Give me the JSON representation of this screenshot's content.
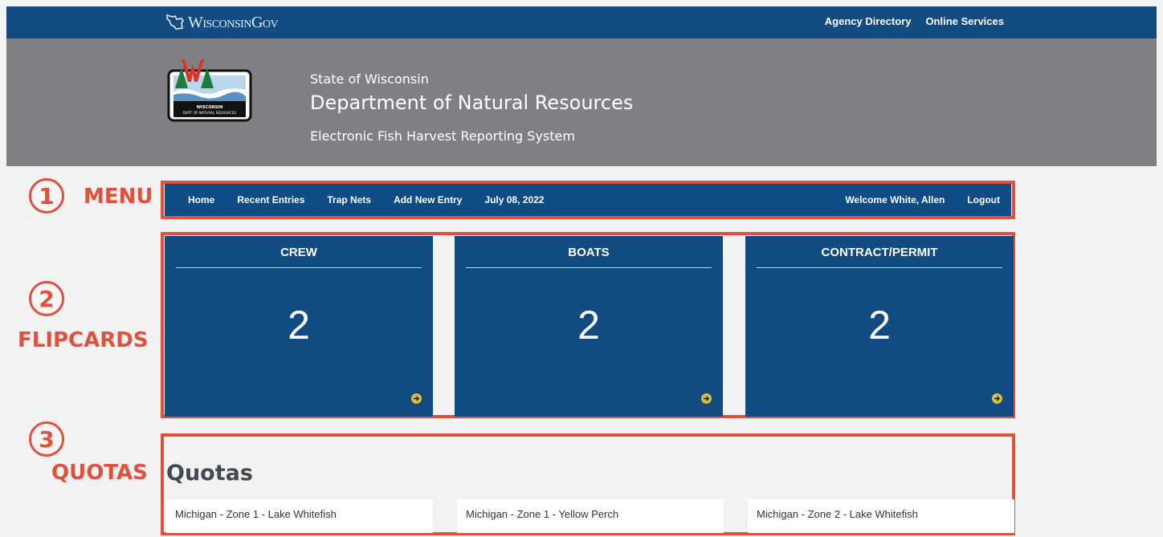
{
  "gov_bar": {
    "logo_text": "WisconsinGov",
    "links": [
      "Agency Directory",
      "Online Services"
    ]
  },
  "header": {
    "state": "State of Wisconsin",
    "department": "Department of Natural Resources",
    "system": "Electronic Fish Harvest Reporting System",
    "logo_text_line1": "WISCONSIN",
    "logo_text_line2": "DEPT. OF NATURAL RESOURCES"
  },
  "annotations": [
    {
      "number": "1",
      "label": "MENU"
    },
    {
      "number": "2",
      "label": "FLIPCARDS"
    },
    {
      "number": "3",
      "label": "QUOTAS"
    }
  ],
  "menu": {
    "left_items": [
      "Home",
      "Recent Entries",
      "Trap Nets",
      "Add New Entry",
      "July 08, 2022"
    ],
    "welcome": "Welcome White, Allen",
    "logout": "Logout"
  },
  "cards": [
    {
      "title": "CREW",
      "value": "2"
    },
    {
      "title": "BOATS",
      "value": "2"
    },
    {
      "title": "CONTRACT/PERMIT",
      "value": "2"
    }
  ],
  "quotas": {
    "title": "Quotas",
    "items": [
      "Michigan - Zone 1 - Lake Whitefish",
      "Michigan - Zone 1 - Yellow Perch",
      "Michigan - Zone 2 - Lake Whitefish"
    ]
  },
  "colors": {
    "navy": "#134b83",
    "header_gray": "#7f8083",
    "annotation_red": "#e0503c",
    "arrow_gold": "#d9c03a"
  },
  "icons": [
    "wisconsin-state-icon",
    "dnr-logo",
    "arrow-right-circle-icon"
  ]
}
